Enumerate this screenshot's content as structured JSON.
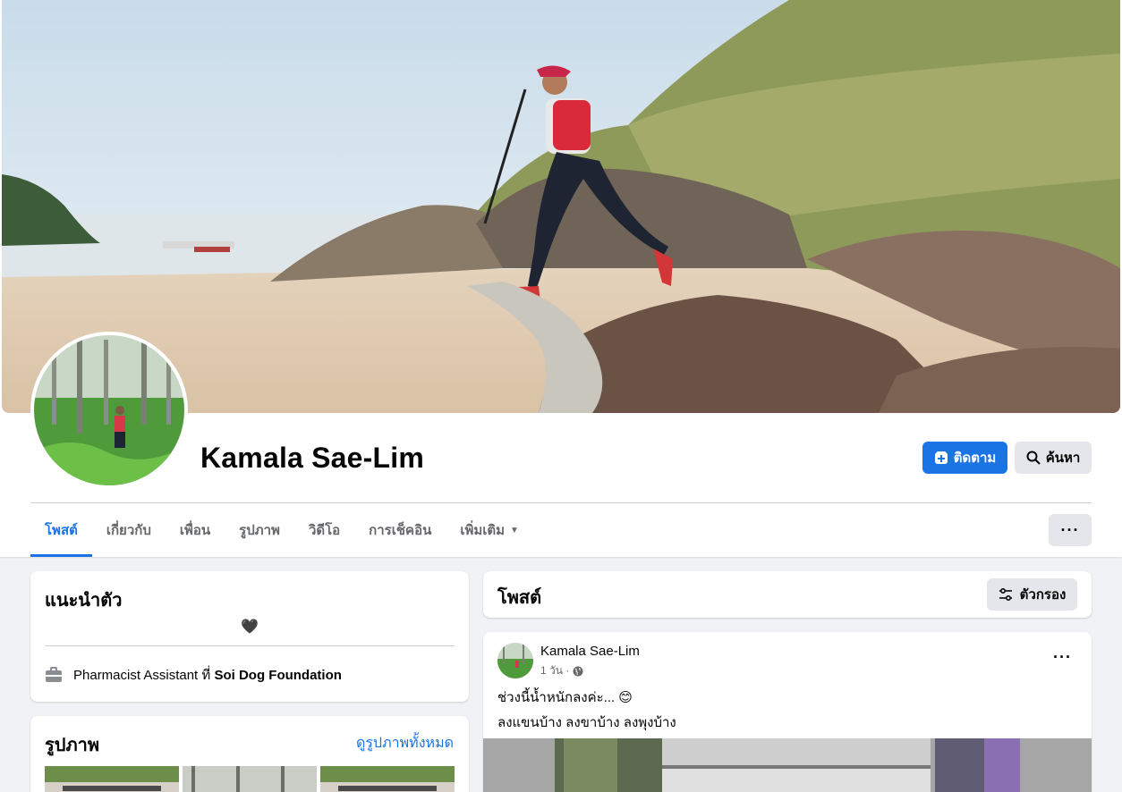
{
  "profile": {
    "name": "Kamala Sae-Lim"
  },
  "actions": {
    "follow_label": "ติดตาม",
    "search_label": "ค้นหา",
    "more_label": "···"
  },
  "tabs": [
    {
      "label": "โพสต์",
      "active": true
    },
    {
      "label": "เกี่ยวกับ"
    },
    {
      "label": "เพื่อน"
    },
    {
      "label": "รูปภาพ"
    },
    {
      "label": "วิดีโอ"
    },
    {
      "label": "การเช็คอิน"
    },
    {
      "label": "เพิ่มเติม"
    }
  ],
  "intro": {
    "title": "แนะนำตัว",
    "bio": "🖤",
    "work_role": "Pharmacist Assistant ที่",
    "work_place": "Soi Dog Foundation"
  },
  "photos": {
    "title": "รูปภาพ",
    "see_all": "ดูรูปภาพทั้งหมด"
  },
  "posts_header": {
    "title": "โพสต์",
    "filter_label": "ตัวกรอง"
  },
  "post": {
    "author": "Kamala Sae-Lim",
    "time": "1 วัน ·",
    "text_line1": "ช่วงนี้น้ำหนักลงค่ะ...",
    "emoji": "😊",
    "text_line2": "ลงแขนบ้าง ลงขาบ้าง ลงพุงบ้าง",
    "more": "···"
  },
  "colors": {
    "accent": "#1b74e4",
    "page_bg": "#f0f2f5",
    "secondary_button": "#e4e6eb",
    "muted_text": "#65676b"
  }
}
